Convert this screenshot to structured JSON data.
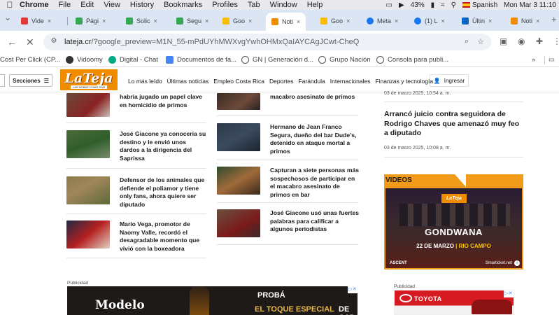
{
  "menubar": {
    "app": "Chrome",
    "items": [
      "File",
      "Edit",
      "View",
      "History",
      "Bookmarks",
      "Profiles",
      "Tab",
      "Window",
      "Help"
    ],
    "battery": "43%",
    "input_language": "Spanish",
    "clock": "Mon Mar 3  11:10"
  },
  "tabs": [
    {
      "label": "Vide",
      "color": "#e53935"
    },
    {
      "label": "Pági",
      "color": "#34a853"
    },
    {
      "label": "Solic",
      "color": "#34a853"
    },
    {
      "label": "Segu",
      "color": "#34a853"
    },
    {
      "label": "Goo",
      "color": "#fbbc04"
    },
    {
      "label": "Noti",
      "color": "#f08c00",
      "active": true
    },
    {
      "label": "Goo",
      "color": "#fbbc04"
    },
    {
      "label": "Meta",
      "color": "#1877f2"
    },
    {
      "label": "(1) L",
      "color": "#1877f2"
    },
    {
      "label": "Últin",
      "color": "#0a66c2"
    },
    {
      "label": "Noti",
      "color": "#f08c00"
    }
  ],
  "toolbar": {
    "url_domain": "lateja.cr",
    "url_path": "/?google_preview=M1N_55-mPdUYhMWXvgYwhOHMxQaIAYCAgJCwt-CheQ"
  },
  "bookmarks": [
    {
      "label": "Cost Per Click (CP...",
      "color": "#4285f4"
    },
    {
      "label": "Vidoomy",
      "color": "#333333"
    },
    {
      "label": "Digital - Chat",
      "color": "#00a884"
    },
    {
      "label": "Documentos de fa...",
      "color": "#4285f4"
    },
    {
      "label": "GN | Generación d...",
      "color": "#555555"
    },
    {
      "label": "Grupo Nación",
      "color": "#555555"
    },
    {
      "label": "Consola para publi...",
      "color": "#555555"
    }
  ],
  "site": {
    "sections_label": "Secciones",
    "logo_text": "LaTeja",
    "logo_tagline": "LAS NOBAS COMO SON",
    "nav": [
      "Lo más leído",
      "Últimas noticias",
      "Empleo Costa Rica",
      "Deportes",
      "Farándula",
      "Internacionales",
      "Finanzas y tecnología"
    ],
    "login_label": "Ingresar"
  },
  "col1": [
    {
      "title": "habría jugado un papel clave en homicidio de primos"
    },
    {
      "title": "José Giacone ya conocería su destino y le envió unos dardos a la dirigencia del Saprissa"
    },
    {
      "title": "Defensor de los animales que defiende el poliamor y tiene only fans, ahora quiere ser diputado"
    },
    {
      "title": "Mario Vega, promotor de Naomy Valle, recordó el desagradable momento que vivió con la boxeadora"
    }
  ],
  "col2": [
    {
      "title": "macabro asesinato de primos"
    },
    {
      "title": "Hermano de Jean Franco Segura, dueño del bar Dude’s, detenido en ataque mortal a primos"
    },
    {
      "title": "Capturan a siete personas más sospechosos de participar en el macabro asesinato de primos en bar"
    },
    {
      "title": "José Giacone usó unas fuertes palabras para calificar a algunos periodistas"
    }
  ],
  "right": {
    "top_date": "03 de marzo 2025, 10:54 a. m.",
    "story_title": "Arrancó juicio contra seguidora de Rodrigo Chaves que amenazó muy feo a diputado",
    "story_date": "03 de marzo 2025, 10:08 a. m.",
    "videos_label": "VIDEOS",
    "video": {
      "mini_logo": "LaTeja",
      "band": "GONDWANA",
      "date_white": "22 DE MARZO",
      "date_yellow": "| RIO CAMPO",
      "sponsor": "ASCENT",
      "ticket": "Smarticket.net"
    }
  },
  "ads": {
    "publicidad": "Publicidad",
    "modelo": {
      "brand": "Modelo",
      "line1": "PROBÁ",
      "line2a": "EL TOQUE ESPECIAL",
      "line2b": "DE CADA COMIDA"
    },
    "toyota": {
      "brand": "TOYOTA"
    }
  }
}
